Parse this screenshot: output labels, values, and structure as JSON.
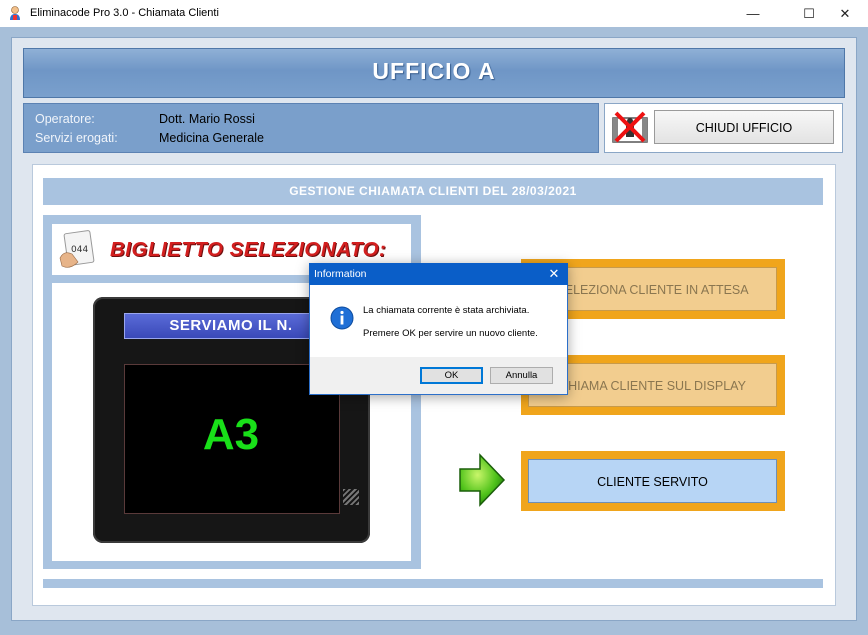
{
  "window": {
    "title": "Eliminacode Pro 3.0 - Chiamata Clienti",
    "minimize": "—",
    "maximize": "☐",
    "close": "✕"
  },
  "header": {
    "office_title": "UFFICIO A"
  },
  "info": {
    "operator_label": "Operatore:",
    "operator_value": "Dott. Mario Rossi",
    "services_label": "Servizi erogati:",
    "services_value": "Medicina Generale"
  },
  "close_office": {
    "label": "CHIUDI UFFICIO"
  },
  "section": {
    "title": "GESTIONE CHIAMATA CLIENTI DEL 28/03/2021"
  },
  "ticket": {
    "icon_number": "044",
    "selected_label": "BIGLIETTO SELEZIONATO:"
  },
  "display": {
    "banner": "SERVIAMO IL N.",
    "number": "A3"
  },
  "actions": {
    "select_waiting": "SELEZIONA CLIENTE IN ATTESA",
    "call_display": "CHIAMA CLIENTE SUL DISPLAY",
    "served": "CLIENTE SERVITO"
  },
  "dialog": {
    "title": "Information",
    "close": "✕",
    "message_line1": "La chiamata corrente è stata archiviata.",
    "message_line2": "Premere OK per servire un nuovo cliente.",
    "ok": "OK",
    "cancel": "Annulla"
  },
  "colors": {
    "accent_blue": "#0a5ec8",
    "button_orange": "#f0a51c",
    "ticket_green": "#19e019",
    "ticket_red": "#d31f1f"
  }
}
